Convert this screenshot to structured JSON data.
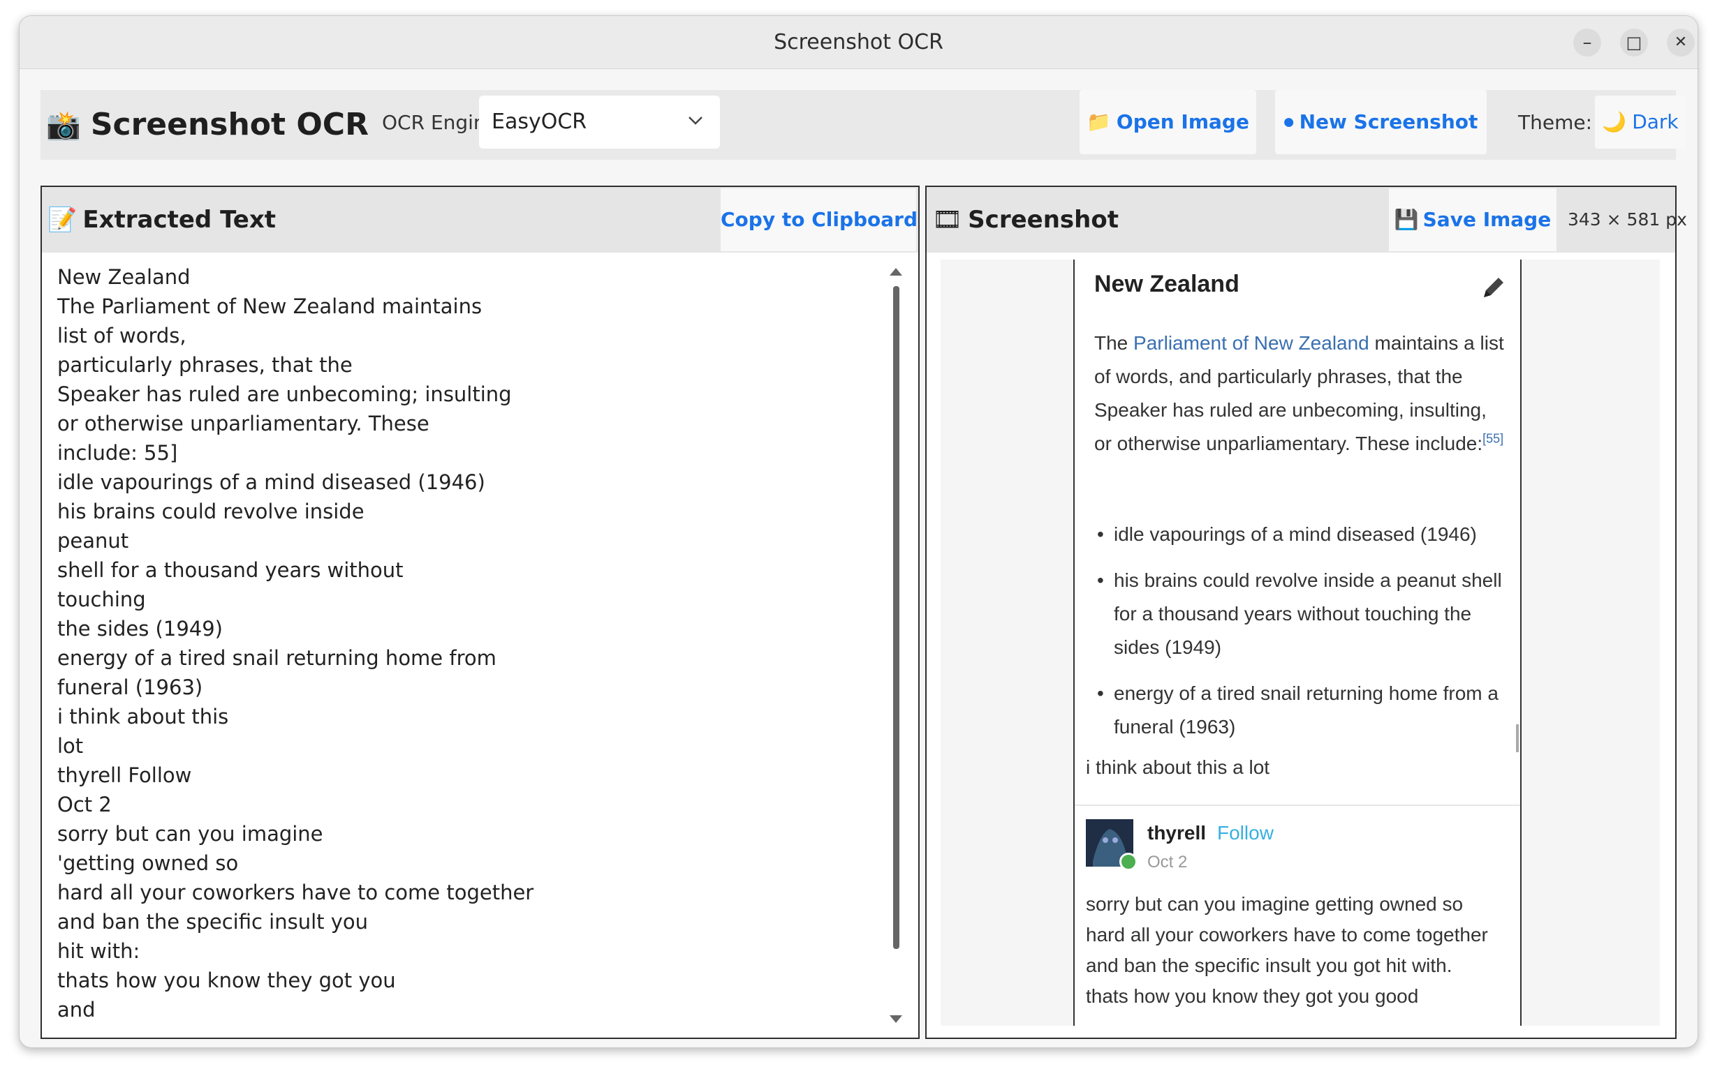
{
  "window": {
    "title": "Screenshot OCR",
    "controls": {
      "minimize": "–",
      "maximize": "□",
      "close": "✕"
    }
  },
  "toolbar": {
    "app_icon": "📸",
    "app_title": "Screenshot OCR",
    "engine_label": "OCR Engine:",
    "engine_value": "EasyOCR",
    "open_icon": "📁",
    "open_label": "Open Image",
    "new_icon": "⏺",
    "new_label": "New Screenshot",
    "theme_label": "Theme:",
    "theme_icon": "🌙",
    "theme_value": "Dark"
  },
  "extracted": {
    "icon": "📝",
    "title": "Extracted Text",
    "copy_label": "Copy to Clipboard",
    "lines": [
      "New Zealand",
      "The Parliament of New Zealand maintains",
      "list of words,",
      "particularly phrases, that the",
      "Speaker has ruled are unbecoming; insulting",
      "or otherwise unparliamentary. These",
      "include: 55]",
      "idle vapourings of a mind diseased (1946)",
      "his brains could revolve inside",
      "peanut",
      "shell for a thousand years without",
      "touching",
      "the sides (1949)",
      "energy of a tired snail returning home from",
      "funeral (1963)",
      "i think about this",
      "lot",
      "thyrell Follow",
      "Oct 2",
      "sorry but can you imagine",
      "'getting owned so",
      "hard all your coworkers have to come together",
      "and ban the specific insult you",
      "hit with:",
      "thats how you know they got you",
      "and"
    ]
  },
  "screenshot": {
    "icon": "🎞",
    "title": "Screenshot",
    "save_icon": "💾",
    "save_label": "Save Image",
    "dimensions": "343 × 581 px",
    "content": {
      "heading": "New Zealand",
      "para_pre": "The ",
      "para_link": "Parliament of New Zealand",
      "para_post": " maintains a list of words, and particularly phrases, that the Speaker has ruled are unbecoming, insulting, or otherwise unparliamentary. These include:",
      "citation": "[55]",
      "bullets": [
        "idle vapourings of a mind diseased (1946)",
        "his brains could revolve inside a peanut shell for a thousand years without touching the sides (1949)",
        "energy of a tired snail returning home from a funeral (1963)"
      ],
      "bullet_char": "•",
      "comment": "i think about this a lot",
      "username": "thyrell",
      "follow": "Follow",
      "date": "Oct 2",
      "post_lines": [
        "sorry but can you imagine getting owned so",
        "hard all your coworkers have to come together",
        "and ban the specific insult you got hit with.",
        "thats how you know they got you good"
      ]
    }
  },
  "colors": {
    "accent": "#1a73e8",
    "link": "#3a6fb0",
    "follow": "#37b0e0"
  }
}
